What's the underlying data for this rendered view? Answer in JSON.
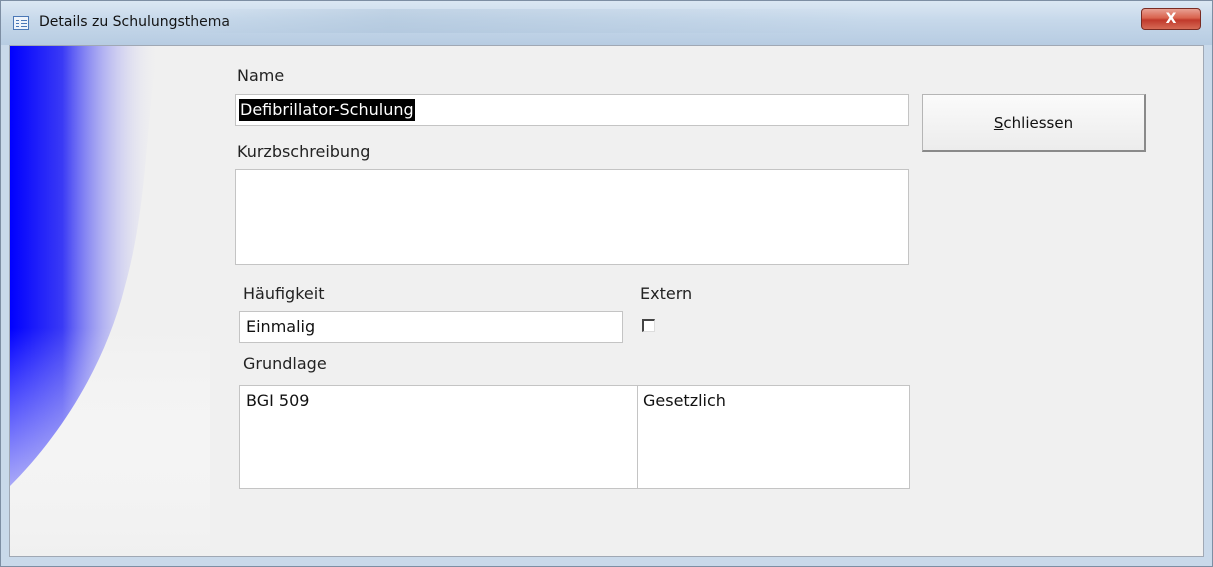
{
  "window": {
    "title": "Details zu Schulungsthema",
    "close_glyph": "X"
  },
  "form": {
    "name_label": "Name",
    "name_value": "Defibrillator-Schulung",
    "description_label": "Kurzbschreibung",
    "description_value": "",
    "frequency_label": "Häufigkeit",
    "frequency_value": "Einmalig",
    "external_label": "Extern",
    "external_checked": false,
    "basis_label": "Grundlage",
    "basis_rows": [
      {
        "basis": "BGI 509",
        "type": "Gesetzlich"
      }
    ]
  },
  "buttons": {
    "close_label_accel": "S",
    "close_label_rest": "chliessen"
  },
  "colors": {
    "accent_gradient": "#0000ff",
    "title_bar": "#c6d8ea",
    "client_bg": "#f0f0f0"
  }
}
